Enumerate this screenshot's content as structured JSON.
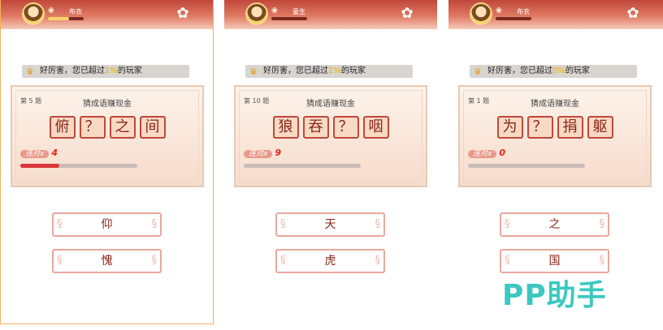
{
  "panels": [
    {
      "player_name": "布衣",
      "exp_fraction": 0.6,
      "banner": {
        "prefix": "好厉害，您已超过",
        "percent": "1%",
        "suffix": "的玩家"
      },
      "question_number": "第 5 题",
      "card_title": "猜成语赚现金",
      "tiles": [
        "俯",
        "？",
        "之",
        "间"
      ],
      "streak_label": "连对x",
      "streak_value": "4",
      "progress_fraction": 0.33,
      "answers": [
        "仰",
        "愧"
      ]
    },
    {
      "player_name": "童生",
      "exp_fraction": 0.0,
      "banner": {
        "prefix": "好厉害，您已超过",
        "percent": "1%",
        "suffix": "的玩家"
      },
      "question_number": "第 10 题",
      "card_title": "猜成语赚现金",
      "tiles": [
        "狼",
        "吞",
        "？",
        "咽"
      ],
      "streak_label": "连对x",
      "streak_value": "9",
      "progress_fraction": 0.0,
      "answers": [
        "天",
        "虎"
      ]
    },
    {
      "player_name": "布衣",
      "exp_fraction": 0.0,
      "banner": {
        "prefix": "好厉害，您已超过",
        "percent": "0%",
        "suffix": "的玩家"
      },
      "question_number": "第 1 题",
      "card_title": "猜成语赚现金",
      "tiles": [
        "为",
        "？",
        "捐",
        "躯"
      ],
      "streak_label": "连对x",
      "streak_value": "0",
      "progress_fraction": 0.0,
      "answers": [
        "之",
        "国"
      ]
    }
  ],
  "icons": {
    "avatar": "avatar-icon",
    "settings": "gear-icon",
    "banner": "trophy-icon",
    "rank": "eye-icon"
  },
  "colors": {
    "accent": "#c0483a",
    "progress": "#d9363a",
    "watermark": "#3cc8c0"
  },
  "watermark": "PP助手"
}
